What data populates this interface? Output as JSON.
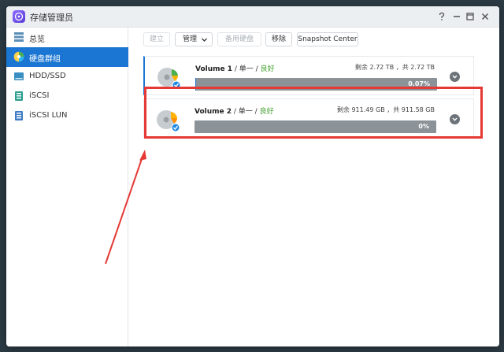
{
  "window": {
    "title": "存储管理员",
    "controls": [
      "help-icon",
      "minimize-icon",
      "maximize-icon",
      "close-icon"
    ]
  },
  "sidebar": {
    "items": [
      {
        "label": "总览",
        "icon": "overview-icon",
        "active": false
      },
      {
        "label": "硬盘群组",
        "icon": "disk-group-icon",
        "active": true
      },
      {
        "label": "HDD/SSD",
        "icon": "hdd-icon",
        "active": false
      },
      {
        "label": "iSCSI",
        "icon": "iscsi-icon",
        "active": false
      },
      {
        "label": "iSCSI LUN",
        "icon": "iscsi-lun-icon",
        "active": false
      }
    ]
  },
  "toolbar": {
    "create_label": "建立",
    "manage_label": "管理",
    "spare_label": "备用硬盘",
    "remove_label": "移除",
    "snapshot_label": "Snapshot Center"
  },
  "volumes": [
    {
      "name": "Volume 1",
      "sep1": " / ",
      "type": "单一",
      "sep2": " / ",
      "status": "良好",
      "stats": "剩余 2.72 TB ，共 2.72 TB",
      "usage_label": "0.07%",
      "usage_fraction": 0.0007
    },
    {
      "name": "Volume 2",
      "sep1": " / ",
      "type": "单一",
      "sep2": " / ",
      "status": "良好",
      "stats": "剩余 911.49 GB ，共 911.58 GB",
      "usage_label": "0%",
      "usage_fraction": 0
    }
  ],
  "colors": {
    "accent": "#1a76d2",
    "status_good": "#40a02b",
    "annotation_red": "#e53935",
    "bar_bg": "#8c9398"
  }
}
